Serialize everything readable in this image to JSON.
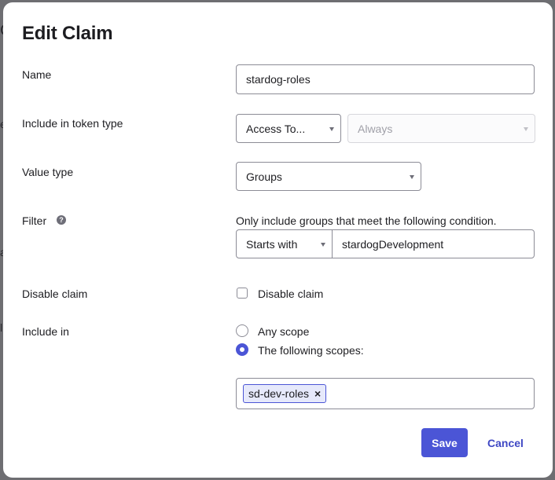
{
  "backdrop": {
    "fragments": [
      "C",
      "e",
      "a",
      "l"
    ]
  },
  "dialog": {
    "title": "Edit Claim",
    "name": {
      "label": "Name",
      "value": "stardog-roles"
    },
    "token_type": {
      "label": "Include in token type",
      "selected": "Access To...",
      "second_selected": "Always"
    },
    "value_type": {
      "label": "Value type",
      "selected": "Groups"
    },
    "filter": {
      "label": "Filter",
      "help_glyph": "?",
      "description": "Only include groups that meet the following condition.",
      "operator": "Starts with",
      "value": "stardogDevelopment"
    },
    "disable_claim": {
      "label": "Disable claim",
      "checkbox_label": "Disable claim",
      "checked": false
    },
    "include_in": {
      "label": "Include in",
      "options": [
        "Any scope",
        "The following scopes:"
      ],
      "selected_index": 1,
      "scopes": [
        "sd-dev-roles"
      ],
      "chip_remove_glyph": "×"
    },
    "buttons": {
      "save": "Save",
      "cancel": "Cancel"
    },
    "colors": {
      "primary": "#4b55d6",
      "chip_bg": "#e6e9fb"
    }
  }
}
